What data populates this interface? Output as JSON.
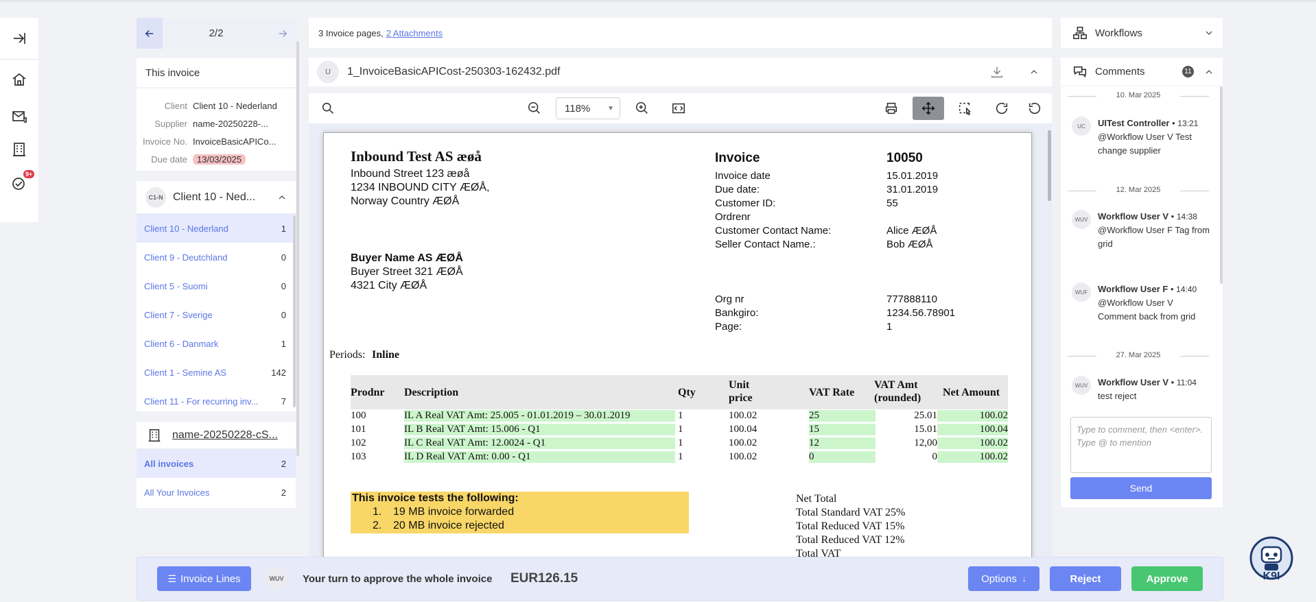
{
  "pager": {
    "position": "2/2"
  },
  "this_invoice": {
    "title": "This invoice",
    "rows": [
      {
        "k": "Client",
        "v": "Client 10 - Nederland"
      },
      {
        "k": "Supplier",
        "v": "name-20250228-..."
      },
      {
        "k": "Invoice No.",
        "v": "InvoiceBasicAPICo..."
      },
      {
        "k": "Due date",
        "v": "13/03/2025"
      }
    ]
  },
  "clients": {
    "avatar": "C1-N",
    "title": "Client 10 - Ned...",
    "items": [
      {
        "label": "Client 10 - Nederland",
        "count": "1"
      },
      {
        "label": "Client 9 - Deutchland",
        "count": "0"
      },
      {
        "label": "Client 5 - Suomi",
        "count": "0"
      },
      {
        "label": "Client 7 - Sverige",
        "count": "0"
      },
      {
        "label": "Client 6 - Danmark",
        "count": "1"
      },
      {
        "label": "Client 1 - Semine AS",
        "count": "142"
      },
      {
        "label": "Client 11 - For recurring inv...",
        "count": "7"
      }
    ]
  },
  "supplier": {
    "title": "name-20250228-cS...",
    "items": [
      {
        "label": "All invoices",
        "count": "2"
      },
      {
        "label": "All Your Invoices",
        "count": "2"
      }
    ]
  },
  "attachments": {
    "pages_text": "3 Invoice pages,",
    "link": "2 Attachments"
  },
  "file": {
    "avatar": "U",
    "name": "1_InvoiceBasicAPICost-250303-162432.pdf"
  },
  "toolbar": {
    "zoom": "118%"
  },
  "doc": {
    "seller_name": "Inbound Test AS æøå",
    "seller_addr": [
      "Inbound Street 123 æøå",
      "1234 INBOUND CITY ÆØÅ,",
      "Norway Country ÆØÅ"
    ],
    "buyer_name": "Buyer Name AS ÆØÅ",
    "buyer_addr": [
      "Buyer Street 321 ÆØÅ",
      "4321 City ÆØÅ"
    ],
    "inv_label": "Invoice",
    "inv_no": "10050",
    "fields": [
      {
        "k": "Invoice date",
        "v": "15.01.2019"
      },
      {
        "k": "Due date:",
        "v": "31.01.2019"
      },
      {
        "k": "Customer ID:",
        "v": "55"
      },
      {
        "k": "Ordrenr",
        "v": ""
      },
      {
        "k": "Customer Contact Name:",
        "v": "Alice ÆØÅ"
      },
      {
        "k": "Seller Contact Name.:",
        "v": "Bob ÆØÅ"
      }
    ],
    "fields2": [
      {
        "k": "Org nr",
        "v": "777888110"
      },
      {
        "k": "Bankgiro:",
        "v": "1234.56.78901"
      },
      {
        "k": "Page:",
        "v": "1"
      }
    ],
    "periods_label": "Periods:",
    "periods_value": "Inline",
    "headers": {
      "prodnr": "Prodnr",
      "desc": "Description",
      "qty": "Qty",
      "unit1": "Unit",
      "unit2": "price",
      "vat": "VAT Rate",
      "vatamt1": "VAT Amt",
      "vatamt2": "(rounded)",
      "net": "Net Amount"
    },
    "lines": [
      {
        "prodnr": "100",
        "desc": "IL A Real VAT Amt: 25.005   - 01.01.2019 – 30.01.2019",
        "qty": "1",
        "price": "100.02",
        "vat": "25",
        "vatamt": "25.01",
        "net": "100.02"
      },
      {
        "prodnr": "101",
        "desc": "IL B Real VAT Amt: 15.006    - Q1",
        "qty": "1",
        "price": "100.04",
        "vat": "15",
        "vatamt": "15.01",
        "net": "100.04"
      },
      {
        "prodnr": "102",
        "desc": "IL C Real VAT Amt: 12.0024    - Q1",
        "qty": "1",
        "price": "100.02",
        "vat": "12",
        "vatamt": "12,00",
        "net": "100.02"
      },
      {
        "prodnr": "103",
        "desc": "IL D Real VAT Amt: 0.00    - Q1",
        "qty": "1",
        "price": "100.02",
        "vat": "0",
        "vatamt": "0",
        "net": "100.02"
      }
    ],
    "tests_title": "This invoice tests the following:",
    "tests": [
      {
        "n": "1.",
        "t": "19 MB invoice forwarded"
      },
      {
        "n": "2.",
        "t": "20 MB invoice rejected"
      }
    ],
    "totals": [
      "Net Total",
      "Total Standard VAT 25%",
      "Total Reduced VAT 15%",
      "Total Reduced VAT 12%",
      "Total VAT"
    ]
  },
  "workflows": {
    "title": "Workflows"
  },
  "comments": {
    "title": "Comments",
    "count": "11",
    "groups": [
      {
        "date": "10. Mar 2025",
        "av": "UC",
        "author": "UITest Controller",
        "time": "13:21",
        "mention": "@Workflow User V",
        "text": "Test change supplier"
      },
      {
        "date": "12. Mar 2025",
        "av": "WUV",
        "author": "Workflow User V",
        "time": "14:38",
        "mention": "@Workflow User F",
        "text": "Tag from grid"
      },
      {
        "date": "",
        "av": "WUF",
        "author": "Workflow User F",
        "time": "14:40",
        "mention": "@Workflow User V",
        "text": "Comment back from grid"
      },
      {
        "date": "27. Mar 2025",
        "av": "WUV",
        "author": "Workflow User V",
        "time": "11:04",
        "mention": "",
        "text": "test reject"
      }
    ],
    "placeholder": "Type to comment, then <enter>. Type @ to mention",
    "send": "Send"
  },
  "footer": {
    "lines_btn": "Invoice Lines",
    "avatar": "WUV",
    "turn_text": "Your turn to approve the whole invoice",
    "amount": "EUR126.15",
    "options": "Options",
    "reject": "Reject",
    "approve": "Approve"
  },
  "rail": {
    "notifications_badge": "9+"
  },
  "robot": {
    "label": "K9I"
  }
}
